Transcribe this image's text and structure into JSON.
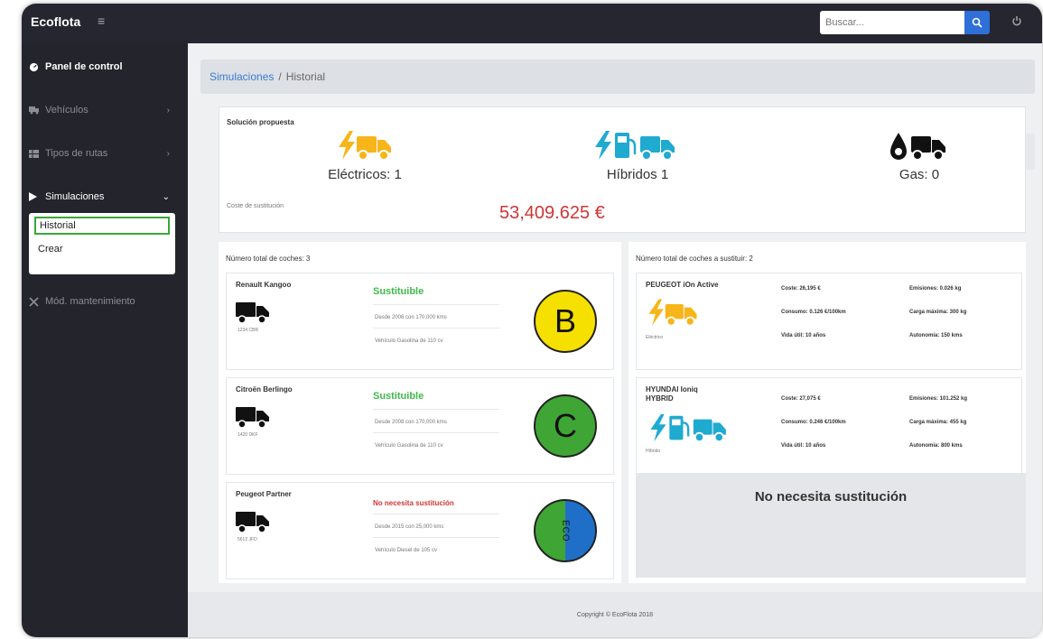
{
  "app": {
    "brand": "Ecoflota",
    "menu_icon": "hamburger-icon",
    "user_icon": "power-icon"
  },
  "search": {
    "placeholder": "Buscar..."
  },
  "sidebar": {
    "items": [
      {
        "label": "Panel de control",
        "icon": "dashboard-icon"
      },
      {
        "label": "Vehículos",
        "icon": "truck-icon"
      },
      {
        "label": "Tipos de rutas",
        "icon": "table-icon"
      },
      {
        "label": "Simulaciones",
        "icon": "play-icon"
      },
      {
        "label": "Mód. mantenimiento",
        "icon": "wrench-icon"
      }
    ],
    "submenu": [
      "Historial",
      "Crear"
    ]
  },
  "breadcrumb": {
    "link": "Simulaciones",
    "separator": "/",
    "current": "Historial"
  },
  "proposal": {
    "title": "Solución propuesta",
    "electricos": "Eléctricos: 1",
    "hibridos": "Híbridos 1",
    "gas": "Gas: 0",
    "cost_label": "Coste de sustitución",
    "cost": "53,409.625 €"
  },
  "left_panel": {
    "title": "Número total de coches: 3",
    "cars": [
      {
        "name": "Renault Kangoo",
        "status": "Sustituible",
        "line1": "Desde 2006 con 170,000 kms",
        "line2": "Vehículo Gasolina de 110 cv",
        "small": "1234 CBR",
        "badge": "B"
      },
      {
        "name": "Citroën Berlingo",
        "status": "Sustituible",
        "line1": "Desde 2008 con 170,000 kms",
        "line2": "Vehículo Gasolina de 110 cv",
        "small": "1420 DKF",
        "badge": "C"
      },
      {
        "name": "Peugeot Partner",
        "status": "No necesita sustitución",
        "line1": "Desde 2015 con 25,000 kms",
        "line2": "Vehículo Diesel de 105 cv",
        "small": "5612 JFD",
        "badge": "ECO"
      }
    ]
  },
  "right_panel": {
    "title": "Número total de coches a sustituir: 2",
    "cars": [
      {
        "name": "PEUGEOT iOn Active",
        "type": "Eléctrico",
        "coste": "Coste: 26,195 €",
        "consumo": "Consumo: 0.126 €/100km",
        "vida": "Vida útil: 10 años",
        "emisiones": "Emisiones: 0.026 kg",
        "carga": "Carga máxima: 300 kg",
        "autonomia": "Autonomía: 150 kms"
      },
      {
        "name": "HYUNDAI Ioniq HYBRID",
        "type": "Híbrido",
        "coste": "Coste: 27,075 €",
        "consumo": "Consumo: 0.246 €/100km",
        "vida": "Vida útil: 10 años",
        "emisiones": "Emisiones: 101.252 kg",
        "carga": "Carga máxima: 455 kg",
        "autonomia": "Autonomía: 800 kms"
      }
    ],
    "no_need": "No necesita sustitución"
  },
  "footer": "Copyright © EcoFlota 2018",
  "colors": {
    "yellow": "#f7b519",
    "teal": "#1faad0",
    "green_ok": "#3fb94a",
    "red": "#d03535"
  }
}
